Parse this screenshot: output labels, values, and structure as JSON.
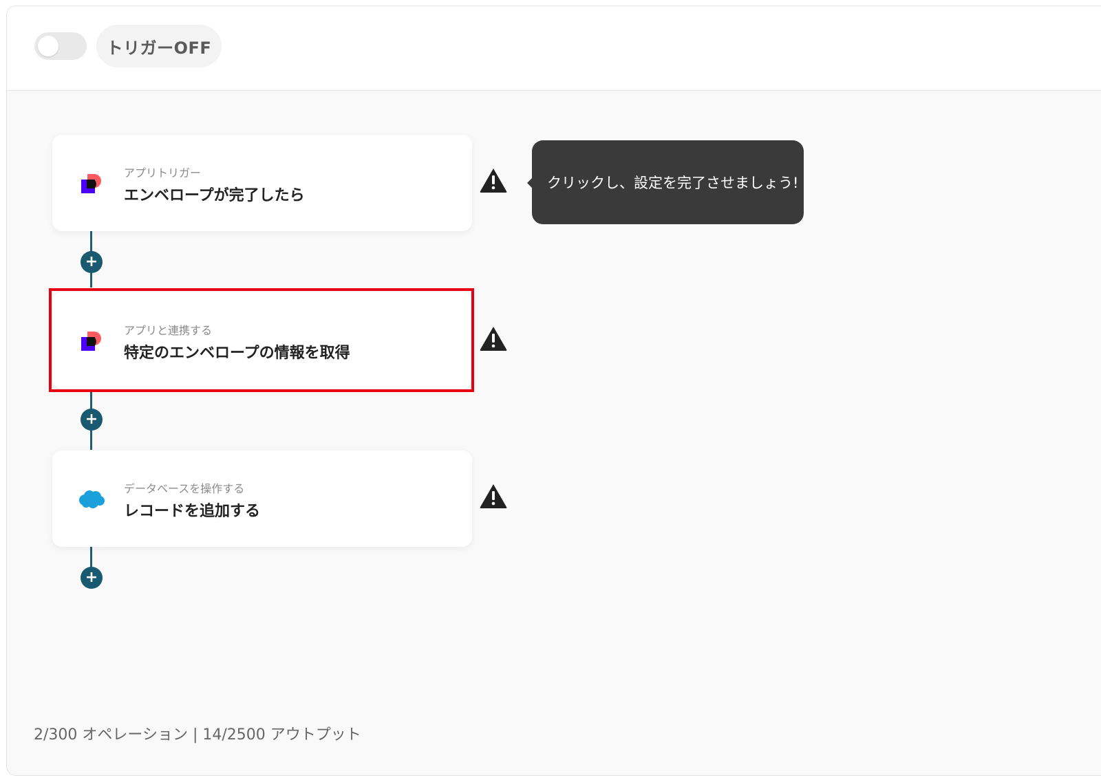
{
  "header": {
    "trigger_label": "トリガーOFF"
  },
  "flow": {
    "steps": [
      {
        "subtitle": "アプリトリガー",
        "title": "エンベロープが完了したら",
        "icon": "docusign-icon"
      },
      {
        "subtitle": "アプリと連携する",
        "title": "特定のエンベロープの情報を取得",
        "icon": "docusign-icon"
      },
      {
        "subtitle": "データベースを操作する",
        "title": "レコードを追加する",
        "icon": "salesforce-cloud-icon"
      }
    ]
  },
  "tooltip": {
    "text": "クリックし、設定を完了させましょう!"
  },
  "footer": {
    "usage": "2/300 オペレーション | 14/2500 アウトプット"
  },
  "colors": {
    "connector": "#1a5a70",
    "highlight": "#e60012",
    "tooltip_bg": "#3a3a3a",
    "salesforce_blue": "#1ba0db"
  }
}
